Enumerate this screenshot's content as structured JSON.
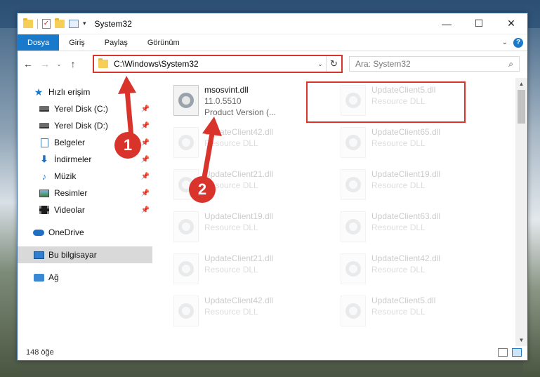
{
  "window": {
    "title": "System32"
  },
  "titlebar": {
    "minimize": "—",
    "maximize": "☐",
    "close": "✕",
    "qat_dropdown": "▾"
  },
  "ribbon": {
    "tabs": [
      {
        "label": "Dosya",
        "active": true
      },
      {
        "label": "Giriş"
      },
      {
        "label": "Paylaş"
      },
      {
        "label": "Görünüm"
      }
    ],
    "collapse": "⌄",
    "help": "?"
  },
  "nav": {
    "back": "←",
    "forward": "→",
    "recent": "⌄",
    "up": "↑",
    "address": "C:\\Windows\\System32",
    "address_dropdown": "⌄",
    "refresh": "↻",
    "search_placeholder": "Ara: System32",
    "search_icon": "⌕"
  },
  "sidebar": {
    "quick_access": "Hızlı erişim",
    "items": [
      {
        "label": "Yerel Disk (C:)",
        "icon": "drive-icon",
        "pinned": true
      },
      {
        "label": "Yerel Disk (D:)",
        "icon": "drive-icon",
        "pinned": true
      },
      {
        "label": "Belgeler",
        "icon": "documents-icon",
        "pinned": true
      },
      {
        "label": "İndirmeler",
        "icon": "downloads-icon",
        "pinned": true
      },
      {
        "label": "Müzik",
        "icon": "music-icon",
        "pinned": true
      },
      {
        "label": "Resimler",
        "icon": "pictures-icon",
        "pinned": true
      },
      {
        "label": "Videolar",
        "icon": "videos-icon",
        "pinned": true
      }
    ],
    "onedrive": "OneDrive",
    "this_pc": "Bu bilgisayar",
    "network": "Ağ",
    "pin": "📌"
  },
  "files": {
    "selected": {
      "name": "msosvint.dll",
      "version": "11.0.5510",
      "desc": "Product Version     (..."
    },
    "items": [
      {
        "name": "UpdateClient5.dll",
        "desc": "Resource DLL"
      },
      {
        "name": "UpdateClient42.dll",
        "desc": "Resource DLL"
      },
      {
        "name": "UpdateClient65.dll",
        "desc": "Resource DLL"
      },
      {
        "name": "UpdateClient21.dll",
        "desc": "Resource DLL"
      },
      {
        "name": "UpdateClient19.dll",
        "desc": "Resource DLL"
      },
      {
        "name": "UpdateClient19.dll",
        "desc": "Resource DLL"
      },
      {
        "name": "UpdateClient63.dll",
        "desc": "Resource DLL"
      },
      {
        "name": "UpdateClient21.dll",
        "desc": "Resource DLL"
      },
      {
        "name": "UpdateClient42.dll",
        "desc": "Resource DLL"
      },
      {
        "name": "UpdateClient42.dll",
        "desc": "Resource DLL"
      },
      {
        "name": "UpdateClient5.dll",
        "desc": "Resource DLL"
      }
    ]
  },
  "status": {
    "count": "148 öğe"
  },
  "annotations": {
    "marker1": "1",
    "marker2": "2",
    "color": "#d9342b"
  },
  "colors": {
    "accent": "#1979ca",
    "highlight": "#d9342b"
  }
}
